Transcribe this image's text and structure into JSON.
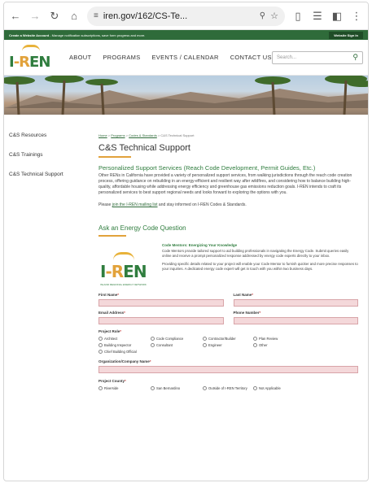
{
  "browser": {
    "url": "iren.gov/162/CS-Te...",
    "back_icon": "arrow-left-icon",
    "forward_icon": "arrow-right-icon",
    "reload_icon": "reload-icon",
    "home_icon": "home-icon"
  },
  "topbar": {
    "message_bold": "Create a Website Account",
    "message_rest": " - Manage notification subscriptions, save form progress and more.",
    "signin_label": "Website Sign In"
  },
  "nav": {
    "logo_text_1": "I",
    "logo_text_dash": "-R",
    "logo_text_2": "EN",
    "links": [
      "ABOUT",
      "PROGRAMS",
      "EVENTS / CALENDAR",
      "CONTACT US"
    ],
    "search_placeholder": "Search..."
  },
  "sidebar": {
    "items": [
      "C&S Resources",
      "C&S Trainings",
      "C&S Technical Support"
    ]
  },
  "main": {
    "breadcrumb": [
      "Home",
      "Programs",
      "Codes & Standards",
      "C&S Technical Support"
    ],
    "title": "C&S Technical Support",
    "subtitle": "Personalized Support Services (Reach Code Development, Permit Guides, Etc.)",
    "intro": "Other RENs in California have provided a variety of personalized support services, from walking jurisdictions through the reach code creation process, offering guidance on rebuilding in an energy-efficient and resilient way after wildfires, and considering how to balance building high-quality, affordable housing while addressing energy efficiency and greenhouse gas emissions reduction goals. I-REN intends to craft its personalized services to best support regional needs and looks forward to exploring the options with you.",
    "please_prefix": "Please ",
    "please_link": "join the I-REN mailing list",
    "please_suffix": " and stay informed on I-REN Codes & Standards.",
    "ask_heading": "Ask an Energy Code Question",
    "mentor_logo_tag": "INLAND REGIONAL ENERGY NETWORK",
    "mentor_heading": "Code Mentors: Energizing Your Knowledge",
    "mentor_p1": "Code Mentors provide tailored support to aid building professionals in navigating the Energy Code. Submit queries easily online and receive a prompt personalized response addressed by energy code experts directly to your inbox.",
    "mentor_p2": "Providing specific details related to your project will enable your Code Mentor to furnish quicker and more precise responses to your inquiries. A dedicated energy code expert will get in touch with you within two business days."
  },
  "form": {
    "first_name": "First Name",
    "last_name": "Last Name",
    "email": "Email Address",
    "phone": "Phone Number",
    "project_role": "Project Role",
    "roles": [
      "Architect",
      "Code Compliance",
      "Contractor/Builder",
      "Plan Review",
      "Building Inspector",
      "Consultant",
      "Engineer",
      "Other",
      "Chief Building Official"
    ],
    "org": "Organization/Company Name",
    "county": "Project County",
    "counties": [
      "Riverside",
      "San Bernardino",
      "Outside of I-REN Territory",
      "Not Applicable"
    ],
    "required_mark": "*"
  }
}
